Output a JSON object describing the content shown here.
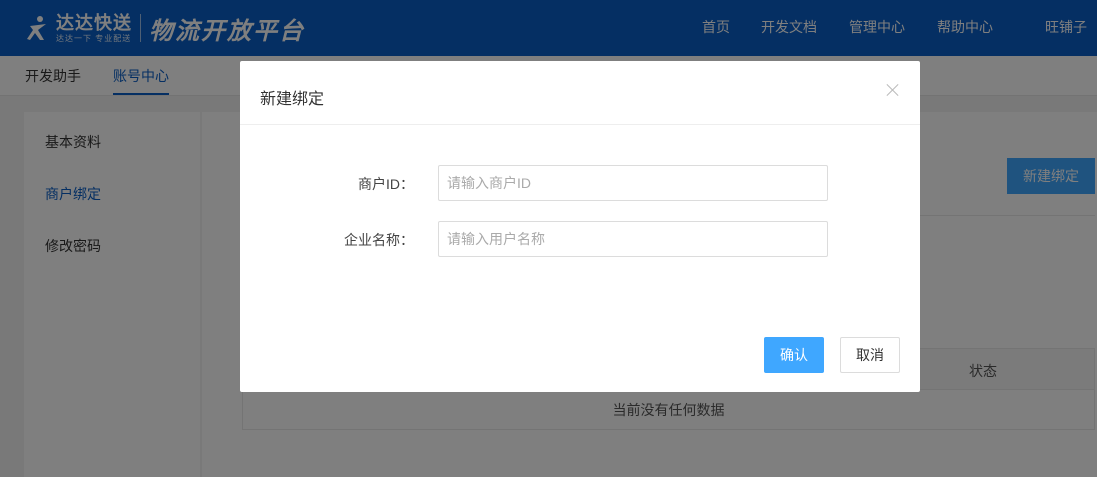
{
  "header": {
    "brand_name": "达达快送",
    "brand_slogan": "达达一下 专业配送",
    "platform_title": "物流开放平台",
    "nav": [
      "首页",
      "开发文档",
      "管理中心",
      "帮助中心",
      "旺铺子"
    ]
  },
  "subnav": {
    "items": [
      "开发助手",
      "账号中心"
    ],
    "active_index": 1
  },
  "sidebar": {
    "items": [
      "基本资料",
      "商户绑定",
      "修改密码"
    ],
    "active_index": 1
  },
  "main": {
    "new_bind_label": "新建绑定",
    "table": {
      "visible_header": "状态",
      "empty_text": "当前没有任何数据"
    }
  },
  "modal": {
    "title": "新建绑定",
    "fields": [
      {
        "label": "商户ID：",
        "placeholder": "请输入商户ID",
        "value": ""
      },
      {
        "label": "企业名称：",
        "placeholder": "请输入用户名称",
        "value": ""
      }
    ],
    "confirm_label": "确认",
    "cancel_label": "取消"
  },
  "colors": {
    "brand_blue": "#0a5fc6",
    "button_blue": "#3fa7ff",
    "overlay": "rgba(0,0,0,0.5)"
  }
}
